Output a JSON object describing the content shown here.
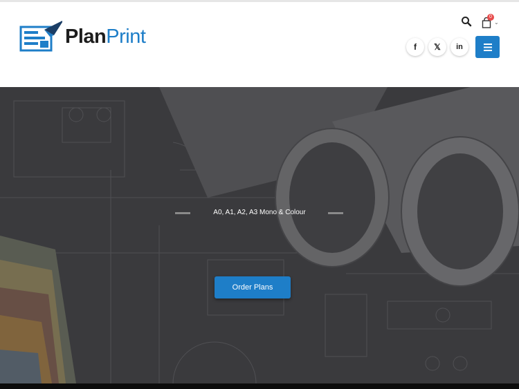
{
  "brand": {
    "name_part1": "Plan",
    "name_part2": "Print",
    "logo_icon": "document-paper-plane-icon"
  },
  "header": {
    "search_icon": "search-icon",
    "cart": {
      "icon": "shopping-bag-icon",
      "count": "0"
    },
    "social": [
      {
        "name": "facebook",
        "glyph": "f"
      },
      {
        "name": "x",
        "glyph": "𝕏"
      },
      {
        "name": "linkedin",
        "glyph": "in"
      }
    ],
    "menu_icon": "hamburger-menu-icon"
  },
  "hero": {
    "subtitle": "A0, A1, A2, A3 Mono & Colour",
    "cta_label": "Order Plans"
  },
  "colors": {
    "accent": "#1e7ec8",
    "badge": "#e74c4c",
    "text_dark": "#1d1d1d"
  }
}
